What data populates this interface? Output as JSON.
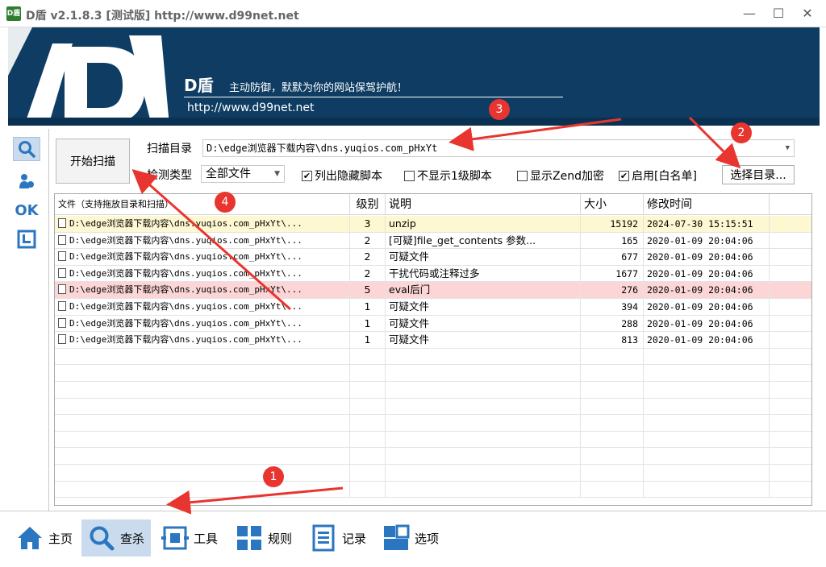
{
  "titlebar": {
    "app_icon_text": "D盾",
    "title": "D盾 v2.1.8.3 [测试版] http://www.d99net.net",
    "minimize": "—",
    "maximize": "☐",
    "close": "✕"
  },
  "banner": {
    "brand": "D盾",
    "slogan": "主动防御，默默为你的网站保驾护航！",
    "url": "http://www.d99net.net"
  },
  "left_icons": [
    "search-icon",
    "user-icon",
    "ok-icon",
    "frame-icon"
  ],
  "left_ok_text": "OK",
  "scan": {
    "start_button": "开始扫描",
    "dir_label": "扫描目录",
    "dir_value": "D:\\edge浏览器下载内容\\dns.yuqios.com_pHxYt",
    "type_label": "检测类型",
    "type_value": "全部文件",
    "checkboxes": [
      {
        "label": "列出隐藏脚本",
        "checked": true
      },
      {
        "label": "不显示1级脚本",
        "checked": false
      },
      {
        "label": "显示Zend加密",
        "checked": false
      },
      {
        "label": "启用[白名单]",
        "checked": true
      }
    ],
    "select_dir_button": "选择目录..."
  },
  "table": {
    "headers": [
      "文件（支持拖放目录和扫描）",
      "级别",
      "说明",
      "大小",
      "修改时间"
    ],
    "rows": [
      {
        "file": "D:\\edge浏览器下载内容\\dns.yuqios.com_pHxYt\\...",
        "level": "3",
        "desc": "unzip",
        "size": "15192",
        "mtime": "2024-07-30 15:15:51",
        "highlight": "yellow"
      },
      {
        "file": "D:\\edge浏览器下载内容\\dns.yuqios.com_pHxYt\\...",
        "level": "2",
        "desc": "[可疑]file_get_contents 参数...",
        "size": "165",
        "mtime": "2020-01-09 20:04:06",
        "highlight": ""
      },
      {
        "file": "D:\\edge浏览器下载内容\\dns.yuqios.com_pHxYt\\...",
        "level": "2",
        "desc": "可疑文件",
        "size": "677",
        "mtime": "2020-01-09 20:04:06",
        "highlight": ""
      },
      {
        "file": "D:\\edge浏览器下载内容\\dns.yuqios.com_pHxYt\\...",
        "level": "2",
        "desc": "干扰代码或注释过多",
        "size": "1677",
        "mtime": "2020-01-09 20:04:06",
        "highlight": ""
      },
      {
        "file": "D:\\edge浏览器下载内容\\dns.yuqios.com_pHxYt\\...",
        "level": "5",
        "desc": "eval后门",
        "size": "276",
        "mtime": "2020-01-09 20:04:06",
        "highlight": "red"
      },
      {
        "file": "D:\\edge浏览器下载内容\\dns.yuqios.com_pHxYt\\...",
        "level": "1",
        "desc": "可疑文件",
        "size": "394",
        "mtime": "2020-01-09 20:04:06",
        "highlight": ""
      },
      {
        "file": "D:\\edge浏览器下载内容\\dns.yuqios.com_pHxYt\\...",
        "level": "1",
        "desc": "可疑文件",
        "size": "288",
        "mtime": "2020-01-09 20:04:06",
        "highlight": ""
      },
      {
        "file": "D:\\edge浏览器下载内容\\dns.yuqios.com_pHxYt\\...",
        "level": "1",
        "desc": "可疑文件",
        "size": "813",
        "mtime": "2020-01-09 20:04:06",
        "highlight": ""
      }
    ]
  },
  "bottom_nav": [
    {
      "label": "主页",
      "icon": "home-icon",
      "active": false
    },
    {
      "label": "查杀",
      "icon": "search-icon",
      "active": true
    },
    {
      "label": "工具",
      "icon": "tools-icon",
      "active": false
    },
    {
      "label": "规则",
      "icon": "grid-icon",
      "active": false
    },
    {
      "label": "记录",
      "icon": "list-icon",
      "active": false
    },
    {
      "label": "选项",
      "icon": "options-icon",
      "active": false
    }
  ],
  "annotations": [
    "1",
    "2",
    "3",
    "4"
  ],
  "colors": {
    "banner": "#0e3c62",
    "accent": "#2b76c0",
    "active_nav": "#c9dbec",
    "row_yellow": "#fdf7d2",
    "row_red": "#fcd6d6",
    "annotation_red": "#e8352f"
  }
}
